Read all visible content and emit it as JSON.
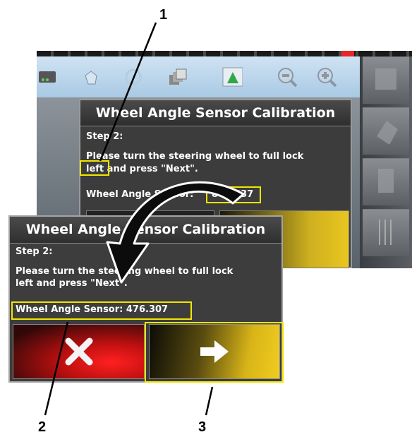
{
  "background_screen": {
    "toolbar_icons": [
      "network-icon",
      "hand-icon",
      "circle-icon",
      "layers-icon",
      "field-map-icon",
      "zoom-out-icon",
      "zoom-in-icon"
    ],
    "side_buttons": [
      "map-view-icon",
      "rotate-icon",
      "boundary-icon",
      "lines-icon"
    ]
  },
  "back_dialog": {
    "title": "Wheel Angle Sensor Calibration",
    "step": "Step 2:",
    "message_line1": "Please turn the steering wheel to full lock",
    "message_line2_highlight": "left",
    "message_line2_rest": " and press \"Next\".",
    "sensor_label": "Wheel Angle Sensor:",
    "sensor_value": "88.3837"
  },
  "front_dialog": {
    "title": "Wheel Angle Sensor Calibration",
    "step": "Step 2:",
    "message_line1": "Please turn the steering wheel to full lock",
    "message_line2": "left and press \"Next\".",
    "sensor_text": "Wheel Angle Sensor: 476.307",
    "cancel_icon": "close-icon",
    "next_icon": "arrow-right-icon"
  },
  "callouts": {
    "c1": "1",
    "c2": "2",
    "c3": "3"
  },
  "colors": {
    "highlight": "#f2e600",
    "cancel_red": "#e81818",
    "next_yellow": "#e9c620"
  }
}
